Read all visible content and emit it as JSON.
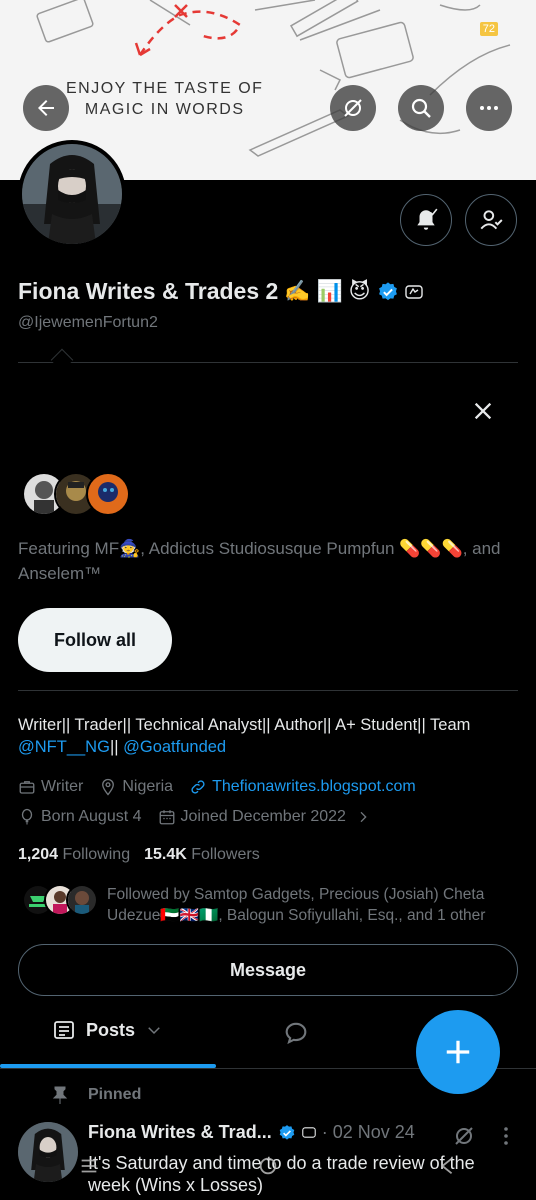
{
  "banner": {
    "tagline_line1": "ENJOY THE TASTE OF",
    "tagline_line2": "MAGIC IN WORDS",
    "corner_badge": "72"
  },
  "top_bar": {
    "back_icon": "arrow-left-icon",
    "grok_icon": "grok-icon",
    "search_icon": "search-icon",
    "more_icon": "more-horizontal-icon"
  },
  "profile": {
    "display_name": "Fiona Writes & Trades 2",
    "name_emojis": [
      "✍️",
      "📊",
      "😈"
    ],
    "verified": true,
    "handle": "@IjewemenFortun2"
  },
  "suggestions": {
    "featuring_text": "Featuring MF🧙, Addictus Studiosusque Pumpfun 💊💊💊, and Anselem™",
    "follow_all_label": "Follow all"
  },
  "bio": {
    "text": "Writer|| Trader|| Technical Analyst|| Author|| A+ Student|| Team ",
    "mention1": "@NFT__NG",
    "separator": "|| ",
    "mention2": "@Goatfunded"
  },
  "meta": {
    "profession": "Writer",
    "location": "Nigeria",
    "website": "Thefionawrites.blogspot.com",
    "birthday": "Born August 4",
    "joined": "Joined December 2022"
  },
  "stats": {
    "following_count": "1,204",
    "following_label": "Following",
    "followers_count": "15.4K",
    "followers_label": "Followers"
  },
  "followed_by": {
    "text": "Followed by Samtop Gadgets, Precious (Josiah) Cheta Udezue🇦🇪🇬🇧🇳🇬, Balogun Sofiyullahi, Esq., and 1 other"
  },
  "actions": {
    "message_label": "Message"
  },
  "tabs": {
    "posts_label": "Posts"
  },
  "pinned_post": {
    "pinned_label": "Pinned",
    "author_name": "Fiona Writes & Trad...",
    "date": "· 02 Nov 24",
    "text": "It's Saturday and time to do a trade review of the week (Wins x Losses)"
  },
  "colors": {
    "accent": "#1d9bf0",
    "background": "#000000",
    "text_primary": "#e7e9ea",
    "text_secondary": "#71767b",
    "border": "#2f3336"
  }
}
